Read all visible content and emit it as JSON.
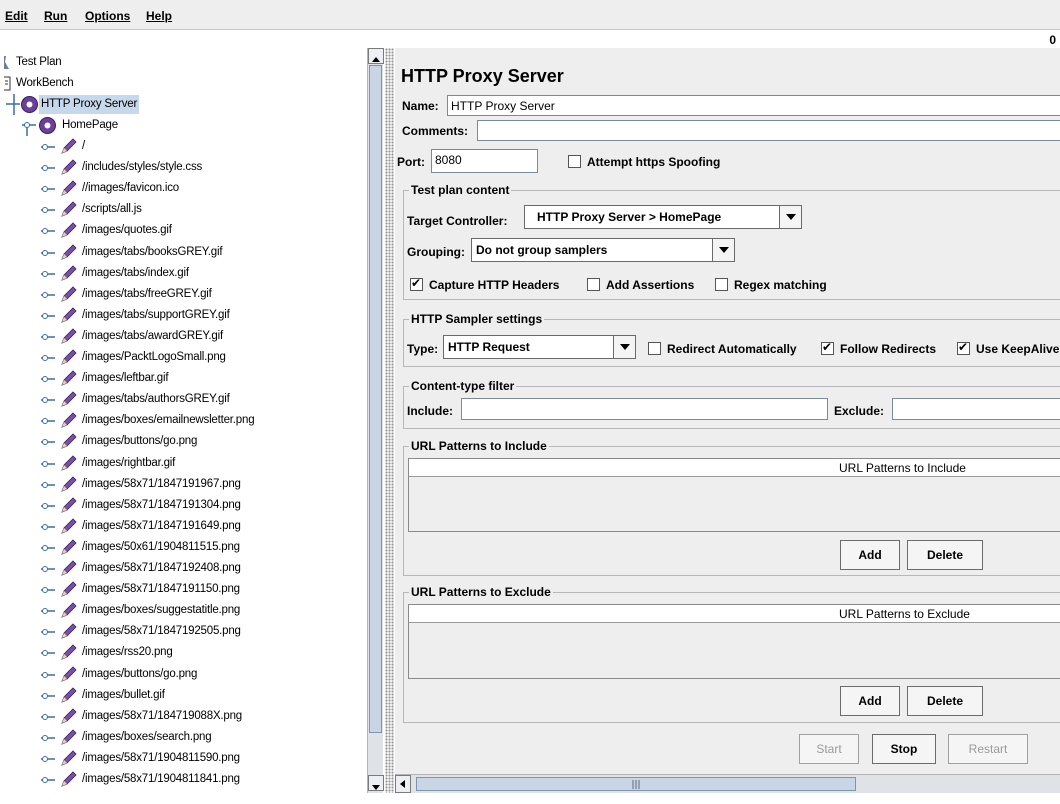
{
  "menu": [
    "Edit",
    "Run",
    "Options",
    "Help"
  ],
  "counter": "0",
  "tree": {
    "root": "Test Plan",
    "workbench": "WorkBench",
    "proxy": "HTTP Proxy Server",
    "homepage": "HomePage",
    "items": [
      "/",
      "/includes/styles/style.css",
      "//images/favicon.ico",
      "/scripts/all.js",
      "/images/quotes.gif",
      "/images/tabs/booksGREY.gif",
      "/images/tabs/index.gif",
      "/images/tabs/freeGREY.gif",
      "/images/tabs/supportGREY.gif",
      "/images/tabs/awardGREY.gif",
      "/images/PacktLogoSmall.png",
      "/images/leftbar.gif",
      "/images/tabs/authorsGREY.gif",
      "/images/boxes/emailnewsletter.png",
      "/images/buttons/go.png",
      "/images/rightbar.gif",
      "/images/58x71/1847191967.png",
      "/images/58x71/1847191304.png",
      "/images/58x71/1847191649.png",
      "/images/50x61/1904811515.png",
      "/images/58x71/1847192408.png",
      "/images/58x71/1847191150.png",
      "/images/boxes/suggestatitle.png",
      "/images/58x71/1847192505.png",
      "/images/rss20.png",
      "/images/buttons/go.png",
      "/images/bullet.gif",
      "/images/58x71/184719088X.png",
      "/images/boxes/search.png",
      "/images/58x71/1904811590.png",
      "/images/58x71/1904811841.png"
    ]
  },
  "panel": {
    "title": "HTTP Proxy Server",
    "name_label": "Name:",
    "name_value": "HTTP Proxy Server",
    "comments_label": "Comments:",
    "port_label": "Port:",
    "port_value": "8080",
    "https_spoofing": {
      "label": "Attempt https Spoofing",
      "checked": false
    },
    "test_plan_content": {
      "title": "Test plan content",
      "target_label": "Target Controller:",
      "target_value": "HTTP Proxy Server > HomePage",
      "grouping_label": "Grouping:",
      "grouping_value": "Do not group samplers",
      "capture_headers": {
        "label": "Capture HTTP Headers",
        "checked": true
      },
      "add_assertions": {
        "label": "Add Assertions",
        "checked": false
      },
      "regex_matching": {
        "label": "Regex matching",
        "checked": false
      }
    },
    "sampler": {
      "title": "HTTP Sampler settings",
      "type_label": "Type:",
      "type_value": "HTTP Request",
      "redirect_auto": {
        "label": "Redirect Automatically",
        "checked": false
      },
      "follow_redirects": {
        "label": "Follow Redirects",
        "checked": true
      },
      "keepalive": {
        "label": "Use KeepAlive",
        "checked": true
      }
    },
    "content_filter": {
      "title": "Content-type filter",
      "include_label": "Include:",
      "exclude_label": "Exclude:"
    },
    "include_patterns": {
      "title": "URL Patterns to Include",
      "column": "URL Patterns to Include",
      "add": "Add",
      "delete": "Delete"
    },
    "exclude_patterns": {
      "title": "URL Patterns to Exclude",
      "column": "URL Patterns to Exclude",
      "add": "Add",
      "delete": "Delete"
    },
    "controls": {
      "start": "Start",
      "stop": "Stop",
      "restart": "Restart"
    }
  },
  "colors": {
    "selection": "#c5d8ec",
    "pencil": "#7a4fa8",
    "gear": "#6b3f9a"
  }
}
